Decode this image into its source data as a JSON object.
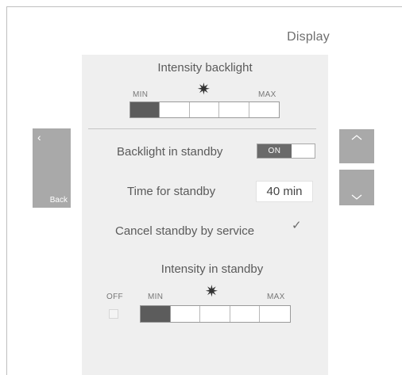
{
  "header": {
    "title": "Display"
  },
  "backlight": {
    "title": "Intensity backlight",
    "min_label": "MIN",
    "max_label": "MAX",
    "level": {
      "filled": 1,
      "segments": 5
    }
  },
  "settings": {
    "backlight_standby_label": "Backlight in standby",
    "backlight_standby_value": "ON",
    "time_standby_label": "Time for standby",
    "time_standby_value": "40 min",
    "cancel_standby_label": "Cancel standby by service",
    "cancel_standby_checked": true
  },
  "standby_intensity": {
    "title": "Intensity in standby",
    "off_label": "OFF",
    "min_label": "MIN",
    "max_label": "MAX",
    "level": {
      "filled": 1,
      "segments": 5
    }
  },
  "nav": {
    "back_label": "Back",
    "icons": [
      "chevron-left-icon",
      "chevron-up-icon",
      "chevron-down-icon"
    ]
  },
  "icons": {
    "brightness": "sun-icon",
    "checkmark": "checkmark-icon"
  }
}
